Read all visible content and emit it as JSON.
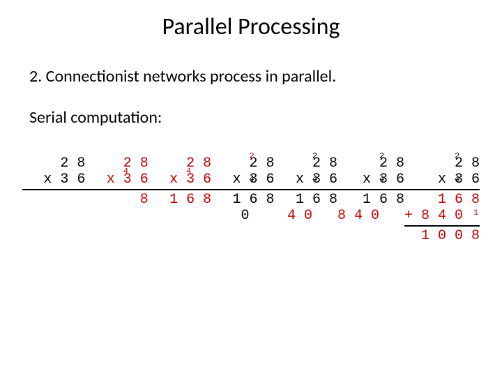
{
  "title": "Parallel Processing",
  "point_text": "2. Connectionist networks process in parallel.",
  "subtitle": "Serial computation:",
  "problem": {
    "top": "2 8",
    "bottom": "x 3 6"
  },
  "steps": [
    {
      "carry_top": "",
      "carry_bot": "",
      "new_digits": "",
      "top_new": "",
      "bot_new": "",
      "p1": "",
      "p1_red": "",
      "p2": "",
      "p2_red": "",
      "sum": "",
      "show_p2": false,
      "show_sum": false,
      "plus": ""
    },
    {
      "carry_top": "",
      "carry_bot": "4    ",
      "p1": "",
      "p1_red": "8",
      "p2": "",
      "show_p2": false,
      "show_sum": false
    },
    {
      "carry_top": "",
      "carry_bot": "4    ",
      "p1": "",
      "p1_red": "1 6 8",
      "p2": "",
      "show_p2": false,
      "show_sum": false
    },
    {
      "carry_top": "2    ",
      "carry_bot": "4    ",
      "p1": "1 6 8",
      "p1_red": "",
      "p2": "0   ",
      "p2_red": "",
      "show_p2": true,
      "show_sum": false
    },
    {
      "carry_top": "2    ",
      "carry_bot": "4    ",
      "p1": "1 6 8",
      "p2": "",
      "p2_red": "4 0   ",
      "show_p2": true,
      "show_sum": false
    },
    {
      "carry_top": "2    ",
      "carry_bot": "4    ",
      "p1": "1 6 8",
      "p2": "",
      "p2_red": "8 4 0   ",
      "show_p2": true,
      "show_sum": false
    },
    {
      "carry_top": "2    ",
      "carry_bot": "4    ",
      "p1": "",
      "p1_red": "1 6 8",
      "p2": "",
      "p2_red": "+ 8 4 0   ",
      "show_p2": true,
      "show_sum": true,
      "sum": "1 0 0 8",
      "col_carry": "1"
    }
  ]
}
